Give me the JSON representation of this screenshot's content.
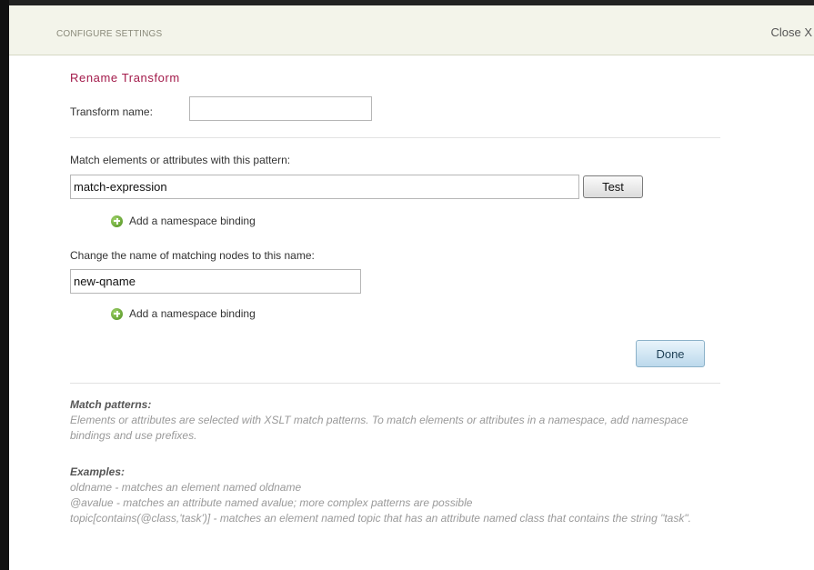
{
  "window": {
    "header_title": "CONFIGURE SETTINGS",
    "close_label": "Close X"
  },
  "form": {
    "section_title": "Rename Transform",
    "transform_name_label": "Transform name:",
    "transform_name_value": "",
    "match_label": "Match elements or attributes with this pattern:",
    "match_value": "match-expression",
    "test_button": "Test",
    "namespace_link_1": "Add a namespace binding",
    "rename_label": "Change the name of matching nodes to this name:",
    "rename_value": "new-qname",
    "namespace_link_2": "Add a namespace binding",
    "done_button": "Done"
  },
  "help": {
    "match_heading": "Match patterns:",
    "match_text": "Elements or attributes are selected with XSLT match patterns. To match elements or attributes in a namespace, add namespace bindings and use prefixes.",
    "examples_heading": "Examples:",
    "examples": [
      "oldname - matches an element named oldname",
      "@avalue - matches an attribute named avalue; more complex patterns are possible",
      "topic[contains(@class,'task')] - matches an element named topic that has an attribute named class that contains the string \"task\"."
    ]
  },
  "icons": {
    "add_namespace": "plus-circle-icon"
  },
  "colors": {
    "section_title": "#a31a4a",
    "header_bg": "#f3f4ea",
    "done_button_bg": "#bcd9ec"
  }
}
